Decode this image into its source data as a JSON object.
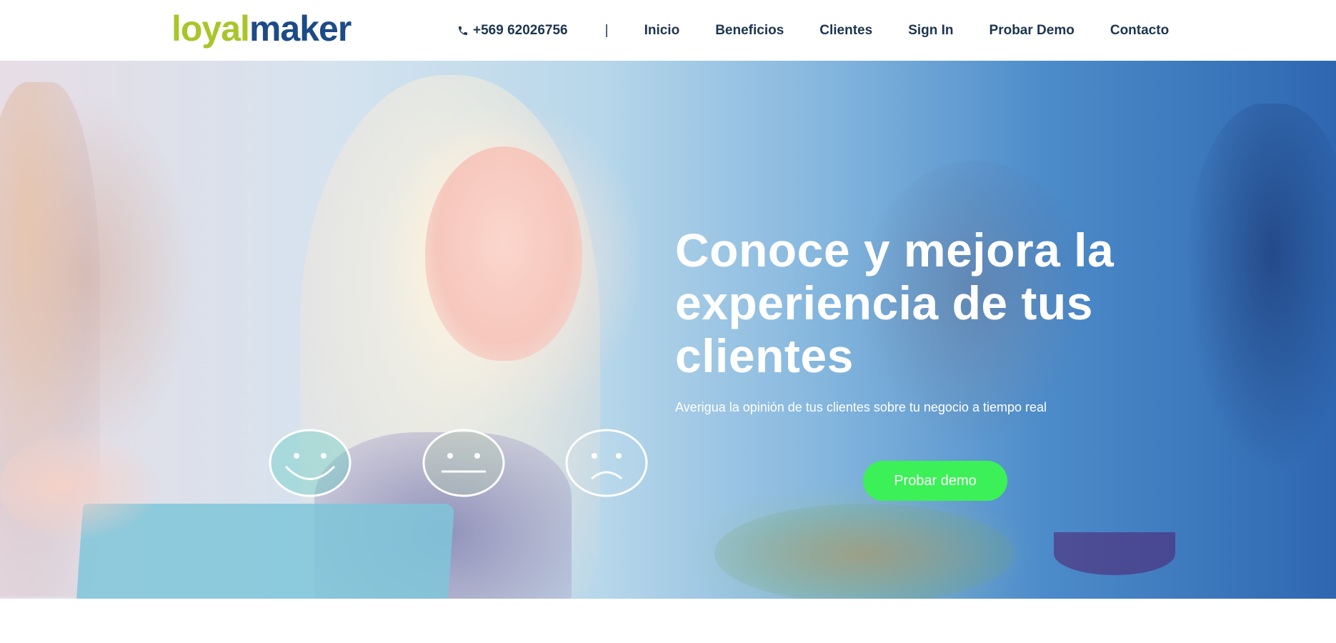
{
  "brand": {
    "logo_part1": "loyal",
    "logo_part2": "maker"
  },
  "nav": {
    "phone": "+569 62026756",
    "separator": "|",
    "items": [
      {
        "label": "Inicio"
      },
      {
        "label": "Beneficios"
      },
      {
        "label": "Clientes"
      },
      {
        "label": "Sign In"
      },
      {
        "label": "Probar Demo"
      },
      {
        "label": "Contacto"
      }
    ]
  },
  "hero": {
    "title": "Conoce y mejora la experiencia de tus clientes",
    "subtitle": "Averigua la opinión de tus clientes sobre tu negocio a tiempo real",
    "cta_label": "Probar demo"
  },
  "colors": {
    "logo_green": "#a8c62a",
    "logo_blue": "#1d4b87",
    "nav_text": "#1c3550",
    "cta_bg": "#3cf057"
  },
  "icons": [
    "phone-icon",
    "happy-face-icon",
    "neutral-face-icon",
    "sad-face-icon"
  ]
}
